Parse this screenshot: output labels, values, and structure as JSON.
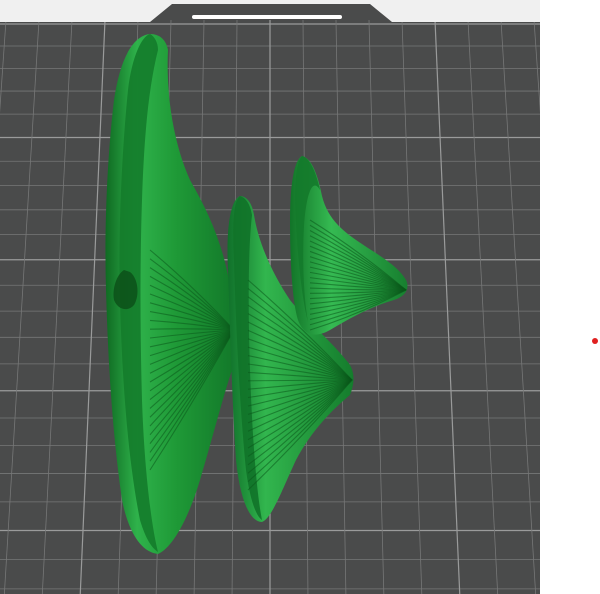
{
  "viewport": {
    "bed_color": "#4a4b4b",
    "grid_minor_color": "#767777",
    "grid_major_color": "#9a9b9b",
    "background_color": "#f0f0f0",
    "model_color": "#1f9a37",
    "model_highlight_color": "#3fc25a",
    "model_shadow_color": "#0d5a1d"
  },
  "indicator": {
    "icon": "axis-origin-dot",
    "color": "#e02020"
  }
}
